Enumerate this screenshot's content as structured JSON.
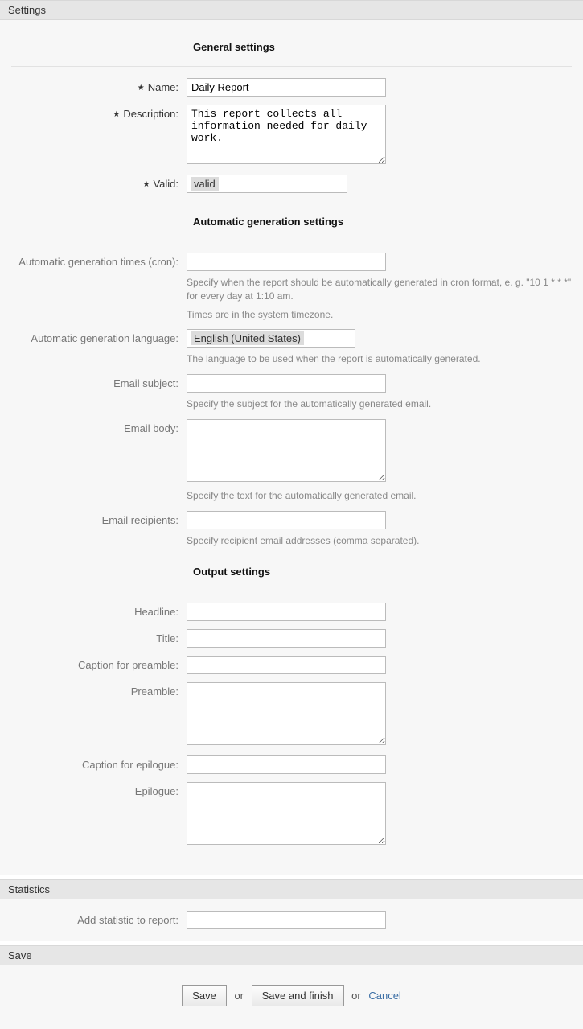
{
  "sections": {
    "settings_header": "Settings",
    "statistics_header": "Statistics",
    "save_header": "Save"
  },
  "general": {
    "heading": "General settings",
    "name_label": "Name:",
    "name_value": "Daily Report",
    "description_label": "Description:",
    "description_value": "This report collects all information needed for daily work.",
    "valid_label": "Valid:",
    "valid_value": "valid"
  },
  "automatic": {
    "heading": "Automatic generation settings",
    "cron_label": "Automatic generation times (cron):",
    "cron_value": "",
    "cron_hint1": "Specify when the report should be automatically generated in cron format, e. g. \"10 1 * * *\" for every day at 1:10 am.",
    "cron_hint2": "Times are in the system timezone.",
    "lang_label": "Automatic generation language:",
    "lang_value": "English (United States)",
    "lang_hint": "The language to be used when the report is automatically generated.",
    "email_subject_label": "Email subject:",
    "email_subject_value": "",
    "email_subject_hint": "Specify the subject for the automatically generated email.",
    "email_body_label": "Email body:",
    "email_body_value": "",
    "email_body_hint": "Specify the text for the automatically generated email.",
    "email_recip_label": "Email recipients:",
    "email_recip_value": "",
    "email_recip_hint": "Specify recipient email addresses (comma separated)."
  },
  "output": {
    "heading": "Output settings",
    "headline_label": "Headline:",
    "headline_value": "",
    "title_label": "Title:",
    "title_value": "",
    "cap_preamble_label": "Caption for preamble:",
    "cap_preamble_value": "",
    "preamble_label": "Preamble:",
    "preamble_value": "",
    "cap_epilogue_label": "Caption for epilogue:",
    "cap_epilogue_value": "",
    "epilogue_label": "Epilogue:",
    "epilogue_value": ""
  },
  "statistics": {
    "add_label": "Add statistic to report:",
    "add_value": ""
  },
  "save": {
    "save_btn": "Save",
    "or": "or",
    "save_finish_btn": "Save and finish",
    "cancel": "Cancel"
  }
}
